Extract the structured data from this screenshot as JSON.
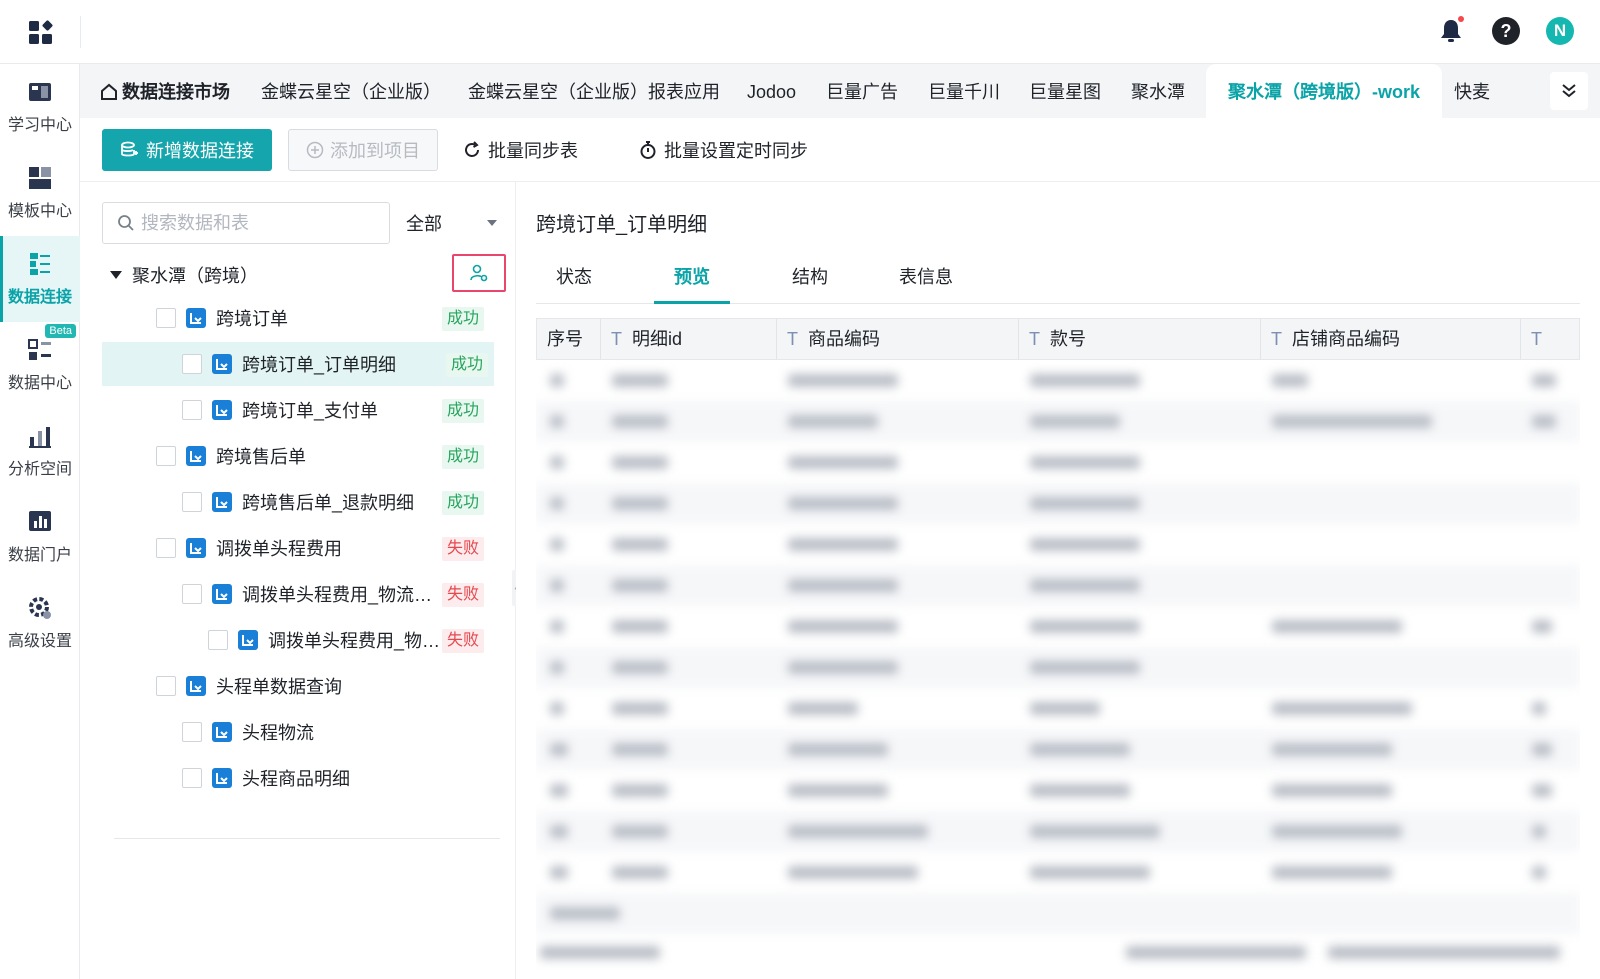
{
  "header": {
    "app_icon": "apps-grid-icon",
    "user_initial": "N",
    "help_label": "?",
    "notification_dot_color": "#f5484d"
  },
  "sidebar": {
    "items": [
      {
        "label": "学习中心",
        "icon": "book-icon"
      },
      {
        "label": "模板中心",
        "icon": "template-icon"
      },
      {
        "label": "数据连接",
        "icon": "data-connection-icon",
        "active": true
      },
      {
        "label": "数据中心",
        "icon": "data-center-icon",
        "badge": "Beta"
      },
      {
        "label": "分析空间",
        "icon": "analysis-icon"
      },
      {
        "label": "数据门户",
        "icon": "portal-icon"
      },
      {
        "label": "高级设置",
        "icon": "settings-gear-icon"
      }
    ]
  },
  "tabs": {
    "home_label": "数据连接市场",
    "items": [
      "金蝶云星空（企业版）",
      "金蝶云星空（企业版）报表应用",
      "Jodoo",
      "巨量广告",
      "巨量千川",
      "巨量星图",
      "聚水潭",
      "聚水潭（跨境版）-work",
      "快麦"
    ],
    "active_index": 7
  },
  "toolbar": {
    "add_connection": "新增数据连接",
    "add_to_project": "添加到项目",
    "batch_sync": "批量同步表",
    "batch_schedule": "批量设置定时同步"
  },
  "tree": {
    "search_placeholder": "搜索数据和表",
    "filter_value": "全部",
    "root_label": "聚水潭（跨境）",
    "nodes": [
      {
        "label": "跨境订单",
        "status": "成功"
      },
      {
        "label": "跨境订单_订单明细",
        "status": "成功"
      },
      {
        "label": "跨境订单_支付单",
        "status": "成功"
      },
      {
        "label": "跨境售后单",
        "status": "成功"
      },
      {
        "label": "跨境售后单_退款明细",
        "status": "成功"
      },
      {
        "label": "调拨单头程费用",
        "status": "失败"
      },
      {
        "label": "调拨单头程费用_物流信息",
        "status": "失败"
      },
      {
        "label": "调拨单头程费用_物流...",
        "status": "失败"
      },
      {
        "label": "头程单数据查询",
        "status": ""
      },
      {
        "label": "头程物流",
        "status": ""
      },
      {
        "label": "头程商品明细",
        "status": ""
      }
    ]
  },
  "content": {
    "title": "跨境订单_订单明细",
    "tabs": [
      "状态",
      "预览",
      "结构",
      "表信息"
    ],
    "active_tab": 1,
    "columns": {
      "index": "序号",
      "type_marker": "T",
      "detail_id": "明细id",
      "product_code": "商品编码",
      "style_no": "款号",
      "shop_product_code": "店铺商品编码"
    }
  },
  "colors": {
    "accent": "#0aa3a8",
    "primary_button": "#14a6ac",
    "success": "#28a55f",
    "fail": "#e5484d",
    "highlight_border": "#e8466c"
  }
}
